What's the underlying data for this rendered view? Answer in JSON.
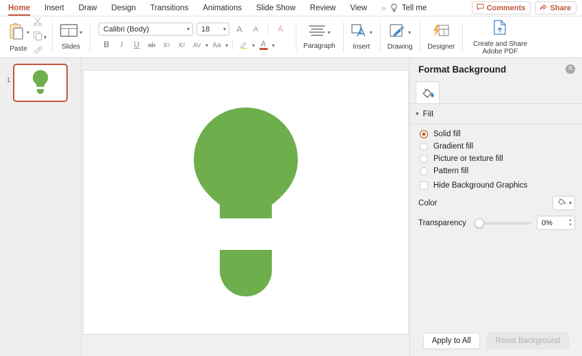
{
  "menubar": {
    "items": [
      {
        "label": "Home",
        "active": true
      },
      {
        "label": "Insert",
        "active": false
      },
      {
        "label": "Draw",
        "active": false
      },
      {
        "label": "Design",
        "active": false
      },
      {
        "label": "Transitions",
        "active": false
      },
      {
        "label": "Animations",
        "active": false
      },
      {
        "label": "Slide Show",
        "active": false
      },
      {
        "label": "Review",
        "active": false
      },
      {
        "label": "View",
        "active": false
      }
    ],
    "overflow": "»",
    "tell_me": "Tell me",
    "comments": "Comments",
    "share": "Share",
    "accent_color": "#c0563a"
  },
  "ribbon": {
    "paste": "Paste",
    "slides": "Slides",
    "font_name": "Calibri (Body)",
    "font_size": "18",
    "grow_font": "A",
    "shrink_font": "A",
    "clear_format": "A",
    "bold": "B",
    "italic": "I",
    "underline": "U",
    "strikethrough": "ab",
    "superscript": "x",
    "subscript": "x",
    "char_spacing": "AV",
    "change_case": "Aa",
    "highlight": "✐",
    "font_color": "A",
    "paragraph": "Paragraph",
    "insert": "Insert",
    "drawing": "Drawing",
    "designer": "Designer",
    "adobe_pdf": "Create and Share\nAdobe PDF",
    "adobe_pdf_line1": "Create and Share",
    "adobe_pdf_line2": "Adobe PDF"
  },
  "thumbnails": {
    "slides": [
      {
        "number": "1",
        "selected": true
      }
    ],
    "selection_color": "#c0563a"
  },
  "slide": {
    "shape_name": "lightbulb",
    "shape_color": "#6fae4c",
    "background_color": "#ffffff"
  },
  "panel": {
    "title": "Format Background",
    "close_label": "✕",
    "tab_icon": "fill-bucket-icon",
    "section": {
      "label": "Fill",
      "expanded": true
    },
    "fill_options": [
      {
        "label": "Solid fill",
        "selected": true
      },
      {
        "label": "Gradient fill",
        "selected": false
      },
      {
        "label": "Picture or texture fill",
        "selected": false
      },
      {
        "label": "Pattern fill",
        "selected": false
      }
    ],
    "hide_background_graphics": {
      "label": "Hide Background Graphics",
      "checked": false
    },
    "color": {
      "label": "Color"
    },
    "transparency": {
      "label": "Transparency",
      "value": "0%",
      "slider_percent": 0
    },
    "apply_to_all": "Apply to All",
    "reset_background": "Reset Background",
    "reset_disabled": true,
    "radio_accent": "#c75b22"
  }
}
